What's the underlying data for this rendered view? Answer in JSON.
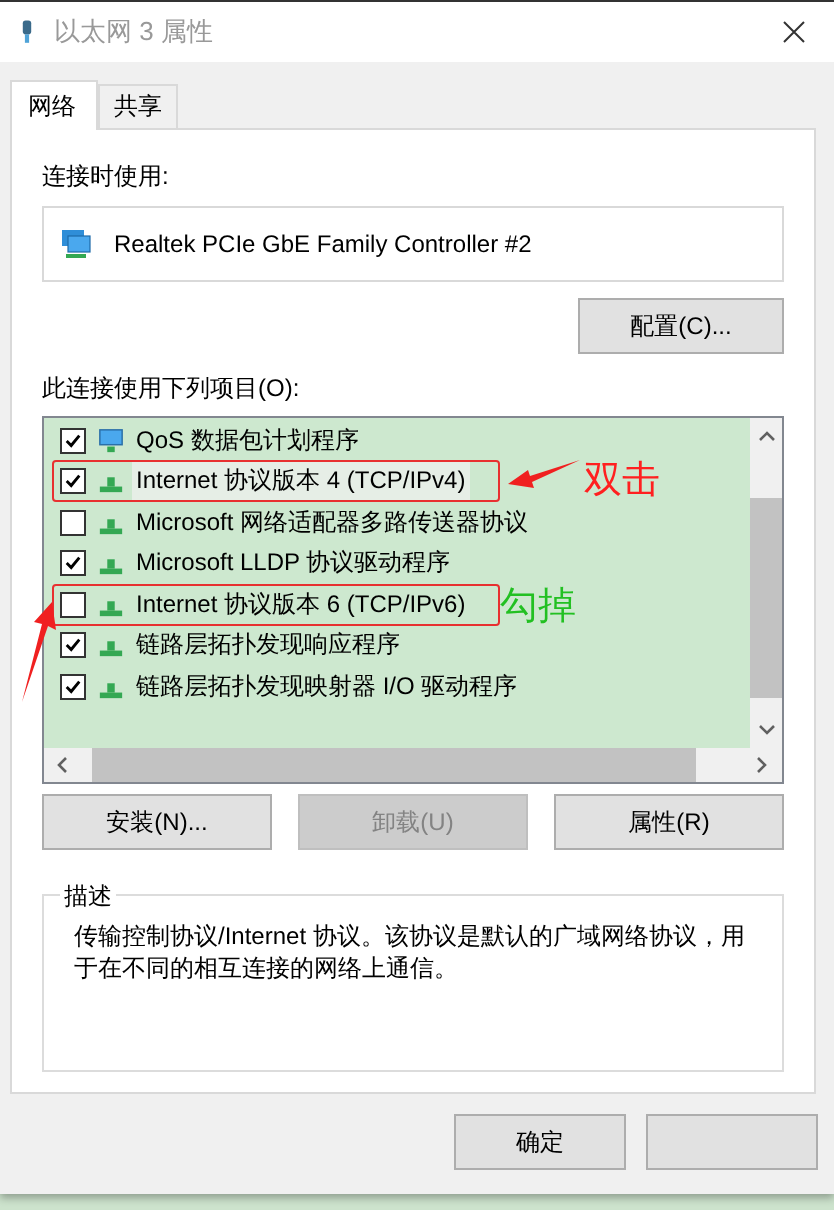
{
  "window": {
    "title": "以太网 3 属性"
  },
  "tabs": [
    {
      "label": "网络",
      "selected": true
    },
    {
      "label": "共享",
      "selected": false
    }
  ],
  "connect_using": {
    "label": "连接时使用:",
    "adapter": "Realtek PCIe GbE Family Controller #2"
  },
  "configure_button": "配置(C)...",
  "items_label": "此连接使用下列项目(O):",
  "items": [
    {
      "label": "QoS 数据包计划程序",
      "checked": true,
      "selected": false,
      "kind": "service"
    },
    {
      "label": "Internet 协议版本 4 (TCP/IPv4)",
      "checked": true,
      "selected": true,
      "kind": "protocol",
      "note": {
        "text": "双击",
        "color": "#ff2020",
        "kind": "left"
      }
    },
    {
      "label": "Microsoft 网络适配器多路传送器协议",
      "checked": false,
      "selected": false,
      "kind": "protocol"
    },
    {
      "label": "Microsoft LLDP 协议驱动程序",
      "checked": true,
      "selected": false,
      "kind": "protocol"
    },
    {
      "label": "Internet 协议版本 6 (TCP/IPv6)",
      "checked": false,
      "selected": false,
      "kind": "protocol",
      "note": {
        "text": "勾掉",
        "color": "#22c022",
        "kind": "up"
      }
    },
    {
      "label": "链路层拓扑发现响应程序",
      "checked": true,
      "selected": false,
      "kind": "protocol"
    },
    {
      "label": "链路层拓扑发现映射器 I/O 驱动程序",
      "checked": true,
      "selected": false,
      "kind": "protocol"
    }
  ],
  "item_buttons": [
    {
      "label": "安装(N)...",
      "disabled": false
    },
    {
      "label": "卸载(U)",
      "disabled": true
    },
    {
      "label": "属性(R)",
      "disabled": false
    }
  ],
  "description": {
    "title": "描述",
    "text": "传输控制协议/Internet 协议。该协议是默认的广域网络协议，用于在不同的相互连接的网络上通信。"
  },
  "ok_button": "确定"
}
